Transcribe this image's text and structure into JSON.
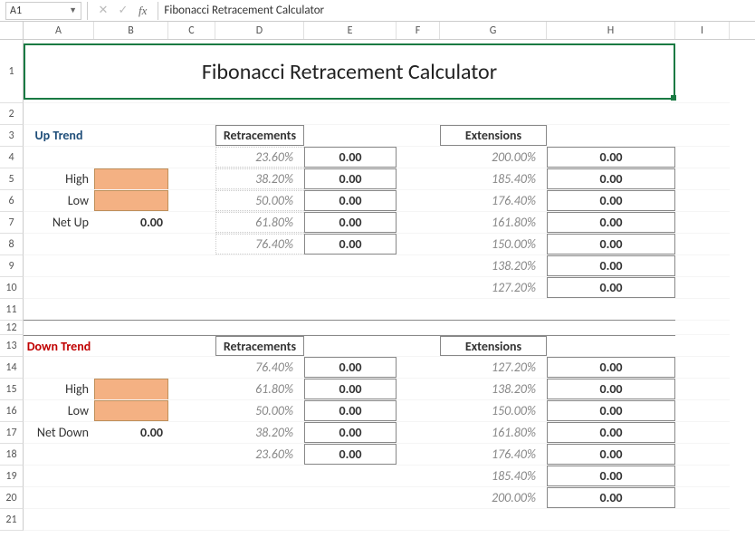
{
  "name_box": "A1",
  "formula_bar": "Fibonacci Retracement Calculator",
  "columns": [
    "A",
    "B",
    "C",
    "D",
    "E",
    "F",
    "G",
    "H",
    "I"
  ],
  "rows": [
    "1",
    "2",
    "3",
    "4",
    "5",
    "6",
    "7",
    "8",
    "9",
    "10",
    "11",
    "12",
    "13",
    "14",
    "15",
    "16",
    "17",
    "18",
    "19",
    "20",
    "21"
  ],
  "title": "Fibonacci Retracement Calculator",
  "up": {
    "label": "Up Trend",
    "high": "High",
    "low": "Low",
    "net": "Net Up",
    "net_val": "0.00",
    "retr_header": "Retracements",
    "ext_header": "Extensions",
    "retr": [
      {
        "pct": "23.60%",
        "val": "0.00"
      },
      {
        "pct": "38.20%",
        "val": "0.00"
      },
      {
        "pct": "50.00%",
        "val": "0.00"
      },
      {
        "pct": "61.80%",
        "val": "0.00"
      },
      {
        "pct": "76.40%",
        "val": "0.00"
      }
    ],
    "ext": [
      {
        "pct": "200.00%",
        "val": "0.00"
      },
      {
        "pct": "185.40%",
        "val": "0.00"
      },
      {
        "pct": "176.40%",
        "val": "0.00"
      },
      {
        "pct": "161.80%",
        "val": "0.00"
      },
      {
        "pct": "150.00%",
        "val": "0.00"
      },
      {
        "pct": "138.20%",
        "val": "0.00"
      },
      {
        "pct": "127.20%",
        "val": "0.00"
      }
    ]
  },
  "down": {
    "label": "Down Trend",
    "high": "High",
    "low": "Low",
    "net": "Net Down",
    "net_val": "0.00",
    "retr_header": "Retracements",
    "ext_header": "Extensions",
    "retr": [
      {
        "pct": "76.40%",
        "val": "0.00"
      },
      {
        "pct": "61.80%",
        "val": "0.00"
      },
      {
        "pct": "50.00%",
        "val": "0.00"
      },
      {
        "pct": "38.20%",
        "val": "0.00"
      },
      {
        "pct": "23.60%",
        "val": "0.00"
      }
    ],
    "ext": [
      {
        "pct": "127.20%",
        "val": "0.00"
      },
      {
        "pct": "138.20%",
        "val": "0.00"
      },
      {
        "pct": "150.00%",
        "val": "0.00"
      },
      {
        "pct": "161.80%",
        "val": "0.00"
      },
      {
        "pct": "176.40%",
        "val": "0.00"
      },
      {
        "pct": "185.40%",
        "val": "0.00"
      },
      {
        "pct": "200.00%",
        "val": "0.00"
      }
    ]
  }
}
